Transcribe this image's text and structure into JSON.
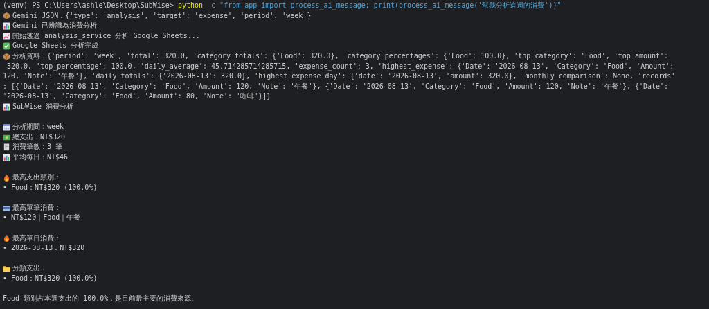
{
  "command": {
    "prompt": "(venv) PS C:\\Users\\ashle\\Desktop\\SubWise>",
    "program": "python",
    "flag": "-c",
    "argument": "\"from app import process_ai_message; print(process_ai_message('幫我分析這週的消費'))\""
  },
  "blocks": [
    {
      "lines": [
        {
          "kind": "package",
          "text": "Gemini JSON：{'type': 'analysis', 'target': 'expense', 'period': 'week'}"
        },
        {
          "kind": "bars",
          "text": "Gemini 已辨識為消費分析"
        },
        {
          "kind": "trend",
          "text": "開始透過 analysis_service 分析 Google Sheets..."
        },
        {
          "kind": "check",
          "text": "Google Sheets 分析完成"
        },
        {
          "kind": "package",
          "text": "分析資料：{'period': 'week', 'total': 320.0, 'category_totals': {'Food': 320.0}, 'category_percentages': {'Food': 100.0}, 'top_category': 'Food', 'top_amount':"
        },
        {
          "kind": "plain",
          "text": " 320.0, 'top_percentage': 100.0, 'daily_average': 45.714285714285715, 'expense_count': 3, 'highest_expense': {'Date': '2026-08-13', 'Category': 'Food', 'Amount':"
        },
        {
          "kind": "plain",
          "text": "120, 'Note': '午餐'}, 'daily_totals': {'2026-08-13': 320.0}, 'highest_expense_day': {'date': '2026-08-13', 'amount': 320.0}, 'monthly_comparison': None, 'records'"
        },
        {
          "kind": "plain",
          "text": ": [{'Date': '2026-08-13', 'Category': 'Food', 'Amount': 120, 'Note': '午餐'}, {'Date': '2026-08-13', 'Category': 'Food', 'Amount': 120, 'Note': '午餐'}, {'Date':"
        },
        {
          "kind": "plain",
          "text": "'2026-08-13', 'Category': 'Food', 'Amount': 80, 'Note': '咖啡'}]}"
        },
        {
          "kind": "bars",
          "text": "SubWise 消費分析"
        }
      ]
    },
    {
      "lines": [
        {
          "kind": "calendar",
          "text": "分析期間：week"
        },
        {
          "kind": "money",
          "text": "總支出：NT$320"
        },
        {
          "kind": "receipt",
          "text": "消費筆數：3 筆"
        },
        {
          "kind": "bars",
          "text": "平均每日：NT$46"
        }
      ]
    },
    {
      "lines": [
        {
          "kind": "fire",
          "text": "最高支出類別："
        },
        {
          "kind": "plain",
          "text": "• Food：NT$320 (100.0%)"
        }
      ]
    },
    {
      "lines": [
        {
          "kind": "card",
          "text": "最高單筆消費："
        },
        {
          "kind": "plain",
          "text": "• NT$120｜Food｜午餐"
        }
      ]
    },
    {
      "lines": [
        {
          "kind": "fire",
          "text": "最高單日消費："
        },
        {
          "kind": "plain",
          "text": "• 2026-08-13：NT$320"
        }
      ]
    },
    {
      "lines": [
        {
          "kind": "folder",
          "text": "分類支出："
        },
        {
          "kind": "plain",
          "text": "• Food：NT$320 (100.0%)"
        }
      ]
    },
    {
      "lines": [
        {
          "kind": "plain",
          "text": "Food 類別占本週支出的 100.0%，是目前最主要的消費來源。"
        }
      ]
    }
  ]
}
